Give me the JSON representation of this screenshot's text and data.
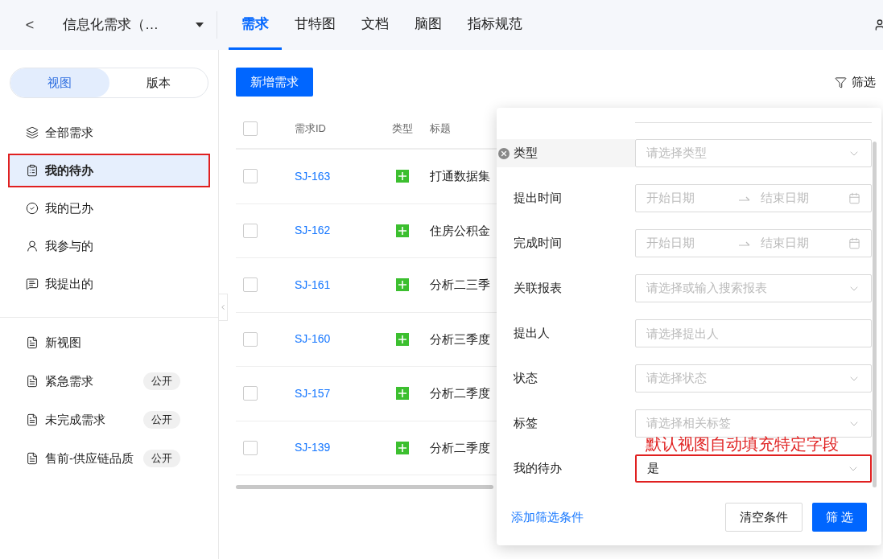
{
  "header": {
    "back": "<",
    "project": "信息化需求（…",
    "tabs": [
      {
        "label": "需求",
        "selected": true
      },
      {
        "label": "甘特图",
        "selected": false
      },
      {
        "label": "文档",
        "selected": false
      },
      {
        "label": "脑图",
        "selected": false
      },
      {
        "label": "指标规范",
        "selected": false
      }
    ]
  },
  "sidebar": {
    "switch": [
      {
        "label": "视图",
        "selected": true
      },
      {
        "label": "版本",
        "selected": false
      }
    ],
    "views": [
      {
        "label": "全部需求",
        "selected": false,
        "annotated": false
      },
      {
        "label": "我的待办",
        "selected": true,
        "annotated": true
      },
      {
        "label": "我的已办",
        "selected": false,
        "annotated": false
      },
      {
        "label": "我参与的",
        "selected": false,
        "annotated": false
      },
      {
        "label": "我提出的",
        "selected": false,
        "annotated": false
      }
    ],
    "custom_views": [
      {
        "label": "新视图",
        "selected": false
      },
      {
        "label": "紧急需求",
        "badge": "公开",
        "selected": false
      },
      {
        "label": "未完成需求",
        "badge": "公开",
        "selected": false
      },
      {
        "label": "售前-供应链品质",
        "badge": "公开",
        "selected": false
      }
    ]
  },
  "toolbar": {
    "add_button": "新增需求",
    "filter_button": "筛选"
  },
  "table": {
    "select_all_checked": false,
    "columns": [
      "需求ID",
      "类型",
      "标题"
    ],
    "rows": [
      {
        "id": "SJ-163",
        "title": "打通数据集",
        "checked": false
      },
      {
        "id": "SJ-162",
        "title": "住房公积金",
        "checked": false
      },
      {
        "id": "SJ-161",
        "title": "分析二三季",
        "checked": false
      },
      {
        "id": "SJ-160",
        "title": "分析三季度",
        "checked": false
      },
      {
        "id": "SJ-157",
        "title": "分析二季度",
        "checked": false
      },
      {
        "id": "SJ-139",
        "title": "分析二季度",
        "checked": false
      }
    ]
  },
  "filter_panel": {
    "fields": [
      {
        "label": "类型",
        "kind": "select",
        "placeholder": "请选择类型",
        "removable": true,
        "annotated": false
      },
      {
        "label": "提出时间",
        "kind": "daterange",
        "start": "开始日期",
        "end": "结束日期",
        "removable": false,
        "annotated": false
      },
      {
        "label": "完成时间",
        "kind": "daterange",
        "start": "开始日期",
        "end": "结束日期",
        "removable": false,
        "annotated": false
      },
      {
        "label": "关联报表",
        "kind": "select",
        "placeholder": "请选择或输入搜索报表",
        "removable": false,
        "annotated": false
      },
      {
        "label": "提出人",
        "kind": "input",
        "placeholder": "请选择提出人",
        "removable": false,
        "annotated": false
      },
      {
        "label": "状态",
        "kind": "select",
        "placeholder": "请选择状态",
        "removable": false,
        "annotated": false
      },
      {
        "label": "标签",
        "kind": "select",
        "placeholder": "请选择相关标签",
        "removable": false,
        "annotated": false
      },
      {
        "label": "我的待办",
        "kind": "select",
        "value": "是",
        "removable": false,
        "annotated": true,
        "annotation": "默认视图自动填充特定字段"
      }
    ],
    "add_condition": "添加筛选条件",
    "clear_button": "清空条件",
    "apply_button": "筛 选"
  }
}
